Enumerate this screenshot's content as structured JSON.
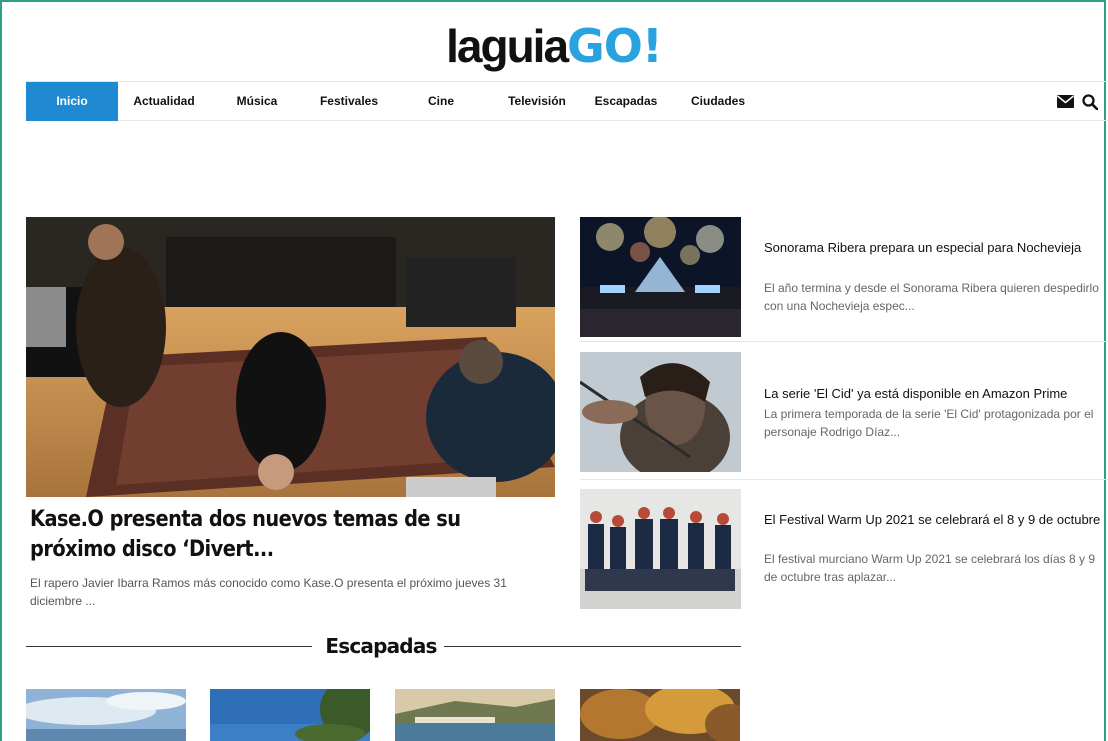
{
  "logo": {
    "part1": "laguia",
    "part2": "GO!"
  },
  "nav": {
    "items": [
      {
        "label": "Inicio"
      },
      {
        "label": "Actualidad"
      },
      {
        "label": "Música"
      },
      {
        "label": "Festivales"
      },
      {
        "label": "Cine"
      },
      {
        "label": "Televisión"
      },
      {
        "label": "Escapadas"
      },
      {
        "label": "Ciudades"
      }
    ],
    "icons": [
      "mail-icon",
      "search-icon"
    ],
    "accent": "#1f8ad1"
  },
  "hero": {
    "title": "Kase.O presenta dos nuevos temas de su próximo disco ‘Divert...",
    "excerpt": "El rapero Javier Ibarra Ramos más conocido como Kase.O presenta el próximo jueves 31 diciembre ..."
  },
  "side_articles": [
    {
      "title": "Sonorama Ribera prepara un especial para Nochevieja",
      "excerpt": "El año termina y desde el Sonorama Ribera quieren despedirlo con una Nochevieja espec..."
    },
    {
      "title": "La serie 'El Cid' ya está disponible en Amazon Prime",
      "excerpt": "La primera temporada de la serie 'El Cid' protagonizada por el personaje Rodrigo Díaz..."
    },
    {
      "title": "El Festival Warm Up 2021 se celebrará el 8 y 9 de octubre",
      "excerpt": "El festival murciano Warm Up 2021 se celebrará los días 8 y 9 de octubre tras aplazar..."
    }
  ],
  "section": {
    "title": "Escapadas"
  },
  "colors": {
    "logo_accent": "#29a3e0",
    "frame": "#2e9e86"
  }
}
